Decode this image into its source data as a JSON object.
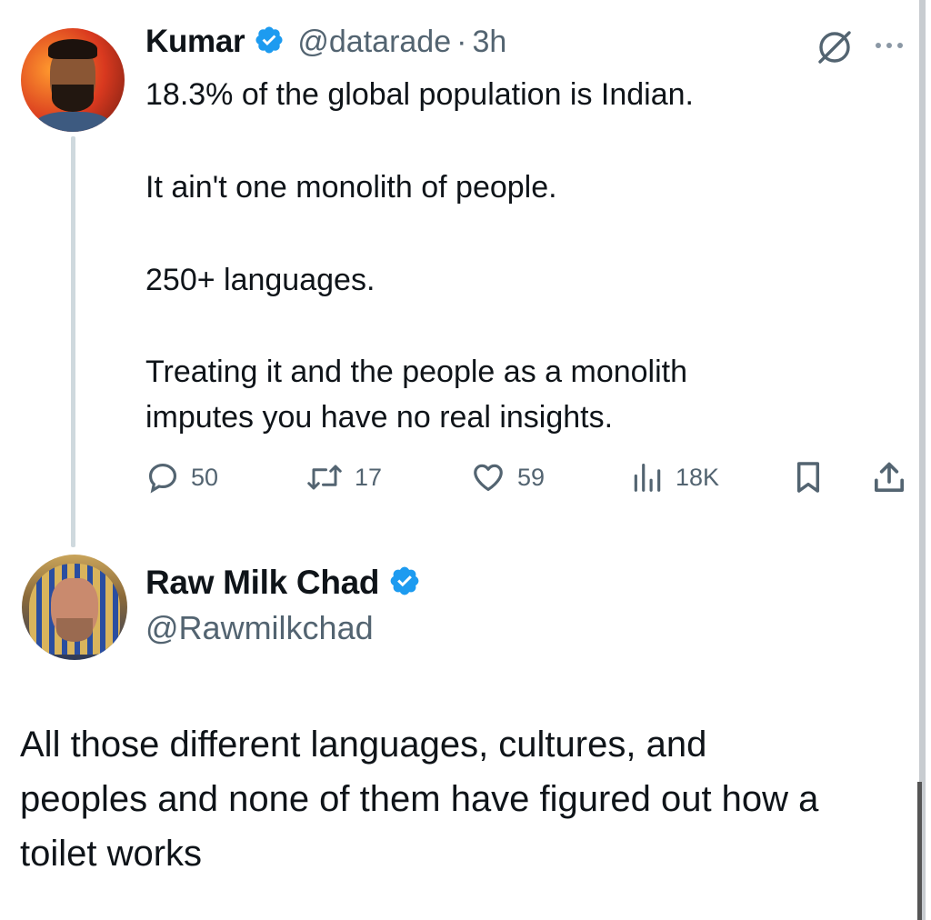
{
  "tweet1": {
    "name": "Kumar",
    "handle": "@datarade",
    "separator": "·",
    "time": "3h",
    "lines": [
      "18.3% of the global population is Indian.",
      "It ain't one monolith of people.",
      "250+ languages.",
      "Treating it and the people as a monolith",
      "imputes you have no real insights."
    ],
    "actions": {
      "replies": "50",
      "retweets": "17",
      "likes": "59",
      "views": "18K"
    }
  },
  "tweet2": {
    "name": "Raw Milk Chad",
    "handle": "@Rawmilkchad",
    "lines": [
      "All those different languages, cultures, and",
      "peoples and none of them have figured out how a",
      "toilet works"
    ]
  },
  "icons": {
    "verified": "verified-badge-icon",
    "grok": "grok-icon",
    "more": "more-icon",
    "reply": "reply-icon",
    "retweet": "retweet-icon",
    "like": "heart-icon",
    "views": "views-icon",
    "bookmark": "bookmark-icon",
    "share": "share-icon"
  },
  "colors": {
    "verified": "#1d9bf0",
    "text": "#0f1419",
    "muted": "#536471"
  }
}
